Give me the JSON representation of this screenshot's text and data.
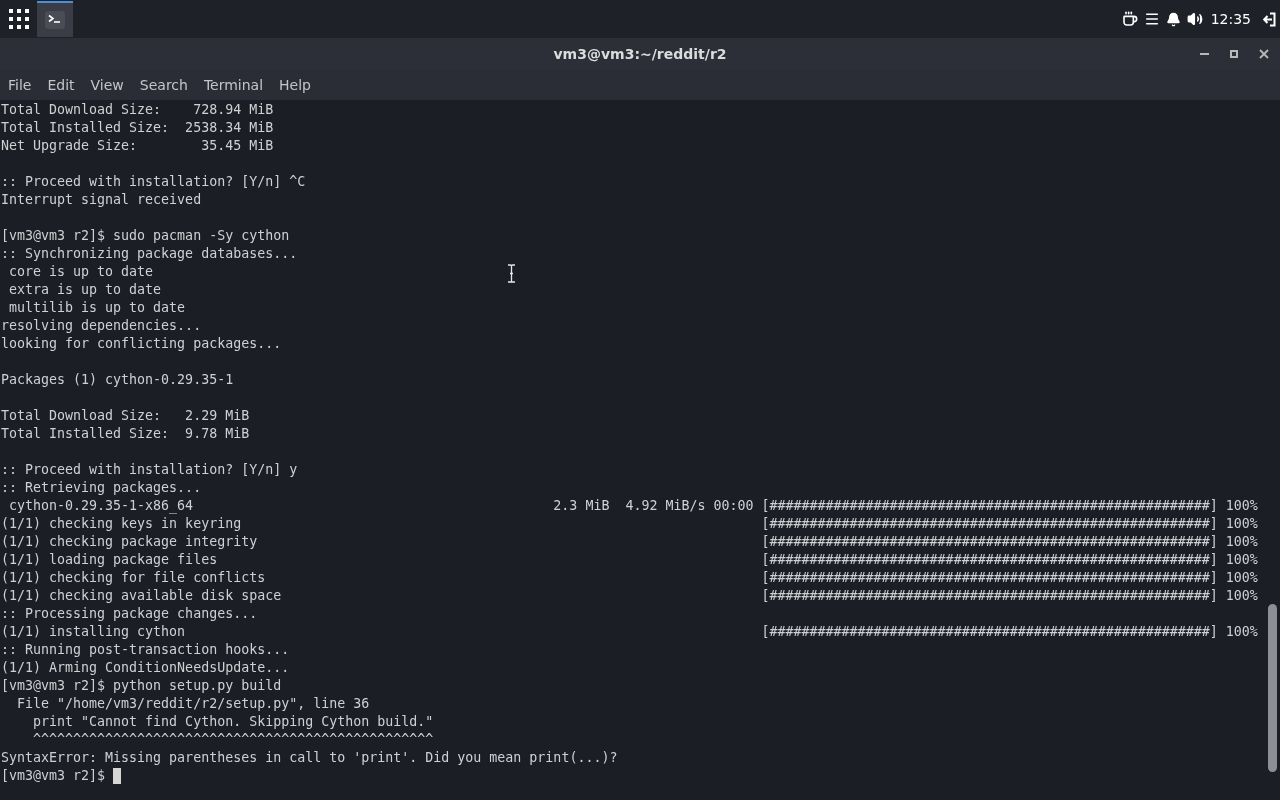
{
  "top_panel": {
    "taskbar_apps": [
      {
        "selected": true
      }
    ],
    "clock": "12:35"
  },
  "window": {
    "title": "vm3@vm3:~/reddit/r2",
    "menu": [
      "File",
      "Edit",
      "View",
      "Search",
      "Terminal",
      "Help"
    ],
    "terminal": {
      "cursor": true,
      "blocks": [
        [
          {
            "text": "Total Download Size:    728.94 MiB"
          },
          {
            "text": "Total Installed Size:  2538.34 MiB"
          },
          {
            "text": "Net Upgrade Size:        35.45 MiB"
          }
        ],
        [
          {
            "text": ":: Proceed with installation? [Y/n] ^C"
          },
          {
            "text": "Interrupt signal received"
          }
        ],
        [
          {
            "text": "[vm3@vm3 r2]$ sudo pacman -Sy cython"
          },
          {
            "text": ":: Synchronizing package databases..."
          },
          {
            "text": " core is up to date"
          },
          {
            "text": " extra is up to date"
          },
          {
            "text": " multilib is up to date"
          },
          {
            "text": "resolving dependencies..."
          },
          {
            "text": "looking for conflicting packages..."
          }
        ],
        [
          {
            "text": "Packages (1) cython-0.29.35-1"
          }
        ],
        [
          {
            "text": "Total Download Size:   2.29 MiB"
          },
          {
            "text": "Total Installed Size:  9.78 MiB"
          }
        ],
        [
          {
            "text": ":: Proceed with installation? [Y/n] y"
          },
          {
            "text": ":: Retrieving packages..."
          },
          {
            "text": " cython-0.29.35-1-x86_64",
            "progress": {
              "stats": "2.3 MiB  4.92 MiB/s 00:00",
              "hashes": "[#######################################################]",
              "percent": "100%"
            }
          },
          {
            "text": "(1/1) checking keys in keyring",
            "progress": {
              "hashes": "[#######################################################]",
              "percent": "100%"
            }
          },
          {
            "text": "(1/1) checking package integrity",
            "progress": {
              "hashes": "[#######################################################]",
              "percent": "100%"
            }
          },
          {
            "text": "(1/1) loading package files",
            "progress": {
              "hashes": "[#######################################################]",
              "percent": "100%"
            }
          },
          {
            "text": "(1/1) checking for file conflicts",
            "progress": {
              "hashes": "[#######################################################]",
              "percent": "100%"
            }
          },
          {
            "text": "(1/1) checking available disk space",
            "progress": {
              "hashes": "[#######################################################]",
              "percent": "100%"
            }
          },
          {
            "text": ":: Processing package changes..."
          },
          {
            "text": "(1/1) installing cython",
            "progress": {
              "hashes": "[#######################################################]",
              "percent": "100%"
            }
          },
          {
            "text": ":: Running post-transaction hooks..."
          },
          {
            "text": "(1/1) Arming ConditionNeedsUpdate..."
          },
          {
            "text": "[vm3@vm3 r2]$ python setup.py build"
          },
          {
            "text": "  File \"/home/vm3/reddit/r2/setup.py\", line 36"
          },
          {
            "text": "    print \"Cannot find Cython. Skipping Cython build.\""
          },
          {
            "text": "    ^^^^^^^^^^^^^^^^^^^^^^^^^^^^^^^^^^^^^^^^^^^^^^^^^^"
          },
          {
            "text": "SyntaxError: Missing parentheses in call to 'print'. Did you mean print(...)?"
          },
          {
            "text": "[vm3@vm3 r2]$"
          }
        ]
      ]
    }
  }
}
